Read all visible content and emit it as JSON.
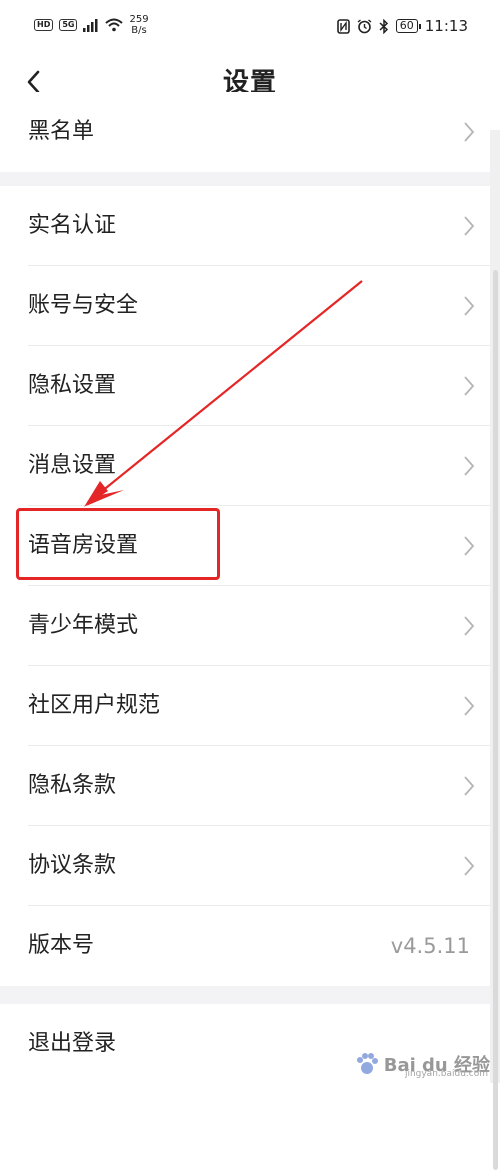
{
  "status_bar": {
    "left_badges": [
      "HD",
      "5G"
    ],
    "net_speed_value": "259",
    "net_speed_unit": "B/s",
    "battery": "60",
    "time": "11:13",
    "icons": [
      "nfc-icon",
      "alarm-icon",
      "bluetooth-icon",
      "battery-icon"
    ]
  },
  "header": {
    "title": "设置",
    "back_icon": "chevron-left-icon"
  },
  "sections": {
    "top": [
      {
        "label": "黑名单"
      }
    ],
    "main": [
      {
        "label": "实名认证"
      },
      {
        "label": "账号与安全"
      },
      {
        "label": "隐私设置"
      },
      {
        "label": "消息设置"
      },
      {
        "label": "语音房设置"
      },
      {
        "label": "青少年模式"
      },
      {
        "label": "社区用户规范"
      },
      {
        "label": "隐私条款"
      },
      {
        "label": "协议条款"
      },
      {
        "label": "版本号",
        "value": "v4.5.11"
      }
    ],
    "bottom": [
      {
        "label": "退出登录"
      }
    ]
  },
  "annotation": {
    "color": "#e52626",
    "highlighted_item": "语音房设置"
  },
  "watermark": {
    "text": "Bai du 经验",
    "sub": "jingyan.baidu.com"
  }
}
